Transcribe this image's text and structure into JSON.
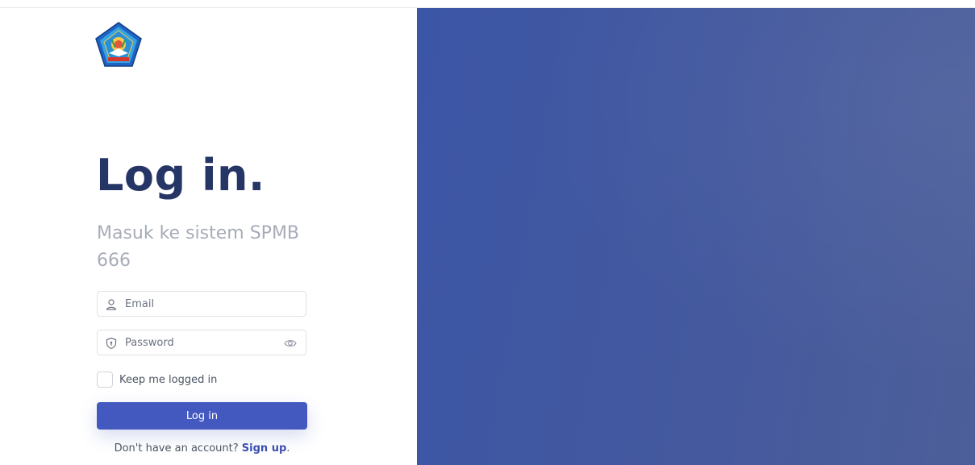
{
  "brand": {
    "logo_icon": "school-pentagon-logo-icon"
  },
  "login": {
    "title": "Log in.",
    "subtitle": "Masuk ke sistem SPMB 666",
    "email": {
      "placeholder": "Email",
      "value": "",
      "icon": "user-icon"
    },
    "password": {
      "placeholder": "Password",
      "value": "",
      "icon": "shield-icon",
      "toggle_icon": "eye-icon"
    },
    "remember": {
      "label": "Keep me logged in",
      "checked": false
    },
    "submit_label": "Log in",
    "signup_prompt": "Don't have an account?",
    "signup_link": "Sign up",
    "signup_suffix": "."
  },
  "colors": {
    "heading": "#253566",
    "subtitle": "#a7acb8",
    "primary": "#4359bf",
    "link": "#3b4fb0",
    "panel": "#3c56a6"
  }
}
